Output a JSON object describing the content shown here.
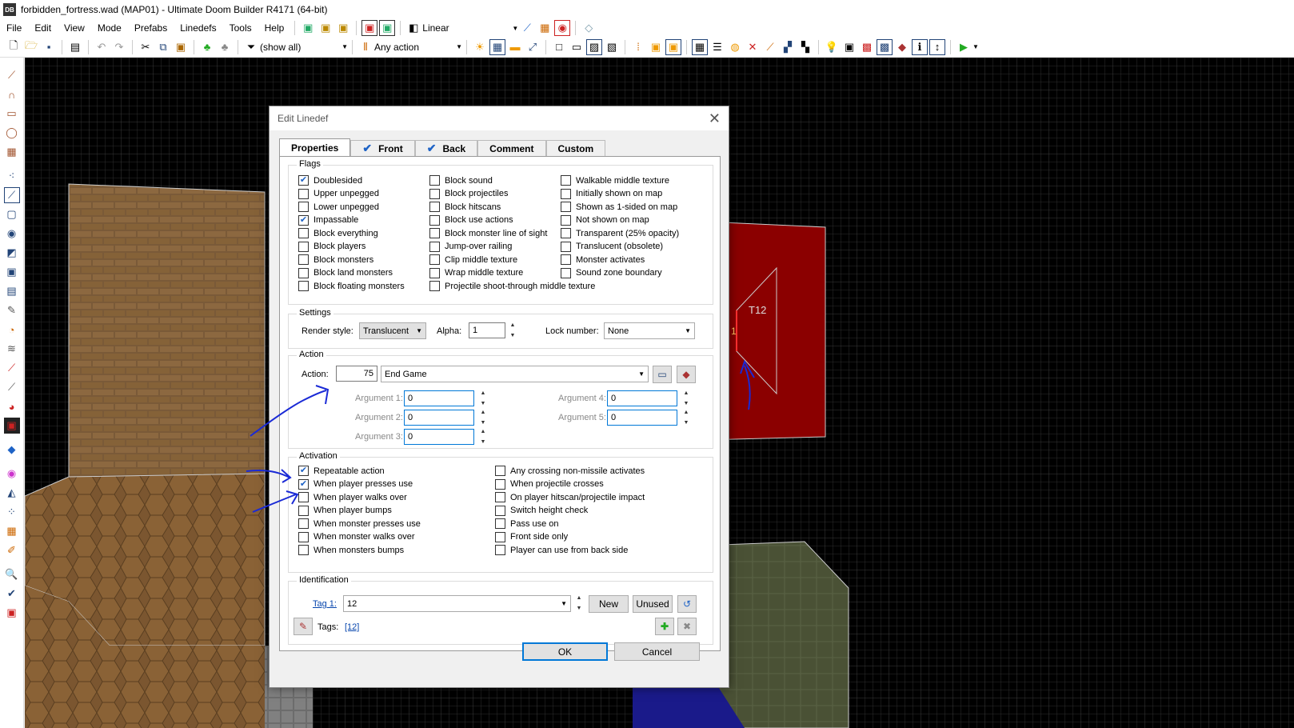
{
  "window": {
    "app_icon": "DB",
    "title": "forbidden_fortress.wad (MAP01) - Ultimate Doom Builder R4171 (64-bit)"
  },
  "menu": [
    "File",
    "Edit",
    "View",
    "Mode",
    "Prefabs",
    "Linedefs",
    "Tools",
    "Help"
  ],
  "toolbar": {
    "interpolation": "Linear",
    "filter": "(show all)",
    "action_filter": "Any action"
  },
  "map": {
    "thing_label": "T12",
    "line_index": "1"
  },
  "dialog": {
    "title": "Edit Linedef",
    "tabs": [
      {
        "label": "Properties",
        "checked": false
      },
      {
        "label": "Front",
        "checked": true
      },
      {
        "label": "Back",
        "checked": true
      },
      {
        "label": "Comment",
        "checked": false
      },
      {
        "label": "Custom",
        "checked": false
      }
    ],
    "flags": {
      "label": "Flags",
      "col1": [
        {
          "label": "Doublesided",
          "checked": true
        },
        {
          "label": "Upper unpegged",
          "checked": false
        },
        {
          "label": "Lower unpegged",
          "checked": false
        },
        {
          "label": "Impassable",
          "checked": true
        },
        {
          "label": "Block everything",
          "checked": false
        },
        {
          "label": "Block players",
          "checked": false
        },
        {
          "label": "Block monsters",
          "checked": false
        },
        {
          "label": "Block land monsters",
          "checked": false
        },
        {
          "label": "Block floating monsters",
          "checked": false
        }
      ],
      "col2": [
        {
          "label": "Block sound",
          "checked": false
        },
        {
          "label": "Block projectiles",
          "checked": false
        },
        {
          "label": "Block hitscans",
          "checked": false
        },
        {
          "label": "Block use actions",
          "checked": false
        },
        {
          "label": "Block monster line of sight",
          "checked": false
        },
        {
          "label": "Jump-over railing",
          "checked": false
        },
        {
          "label": "Clip middle texture",
          "checked": false
        },
        {
          "label": "Wrap middle texture",
          "checked": false
        },
        {
          "label": "Projectile shoot-through middle texture",
          "checked": false
        }
      ],
      "col3": [
        {
          "label": "Walkable middle texture",
          "checked": false
        },
        {
          "label": "Initially shown on map",
          "checked": false
        },
        {
          "label": "Shown as 1-sided on map",
          "checked": false
        },
        {
          "label": "Not shown on map",
          "checked": false
        },
        {
          "label": "Transparent (25% opacity)",
          "checked": false
        },
        {
          "label": "Translucent (obsolete)",
          "checked": false
        },
        {
          "label": "Monster activates",
          "checked": false
        },
        {
          "label": "Sound zone boundary",
          "checked": false
        }
      ]
    },
    "settings": {
      "label": "Settings",
      "render_style_label": "Render style:",
      "render_style": "Translucent",
      "alpha_label": "Alpha:",
      "alpha": "1",
      "lock_label": "Lock number:",
      "lock": "None"
    },
    "action": {
      "label": "Action",
      "action_label": "Action:",
      "number": "75",
      "name": "End Game",
      "args": [
        {
          "label": "Argument 1:",
          "value": "0"
        },
        {
          "label": "Argument 2:",
          "value": "0"
        },
        {
          "label": "Argument 3:",
          "value": "0"
        },
        {
          "label": "Argument 4:",
          "value": "0"
        },
        {
          "label": "Argument 5:",
          "value": "0"
        }
      ]
    },
    "activation": {
      "label": "Activation",
      "col1": [
        {
          "label": "Repeatable action",
          "checked": true
        },
        {
          "label": "When player presses use",
          "checked": true
        },
        {
          "label": "When player walks over",
          "checked": false
        },
        {
          "label": "When player bumps",
          "checked": false
        },
        {
          "label": "When monster presses use",
          "checked": false
        },
        {
          "label": "When monster walks over",
          "checked": false
        },
        {
          "label": "When monsters bumps",
          "checked": false
        }
      ],
      "col2": [
        {
          "label": "Any crossing non-missile activates",
          "checked": false
        },
        {
          "label": "When projectile crosses",
          "checked": false
        },
        {
          "label": "On player hitscan/projectile impact",
          "checked": false
        },
        {
          "label": "Switch height check",
          "checked": false
        },
        {
          "label": "Pass use on",
          "checked": false
        },
        {
          "label": "Front side only",
          "checked": false
        },
        {
          "label": "Player can use from back side",
          "checked": false
        }
      ]
    },
    "identification": {
      "label": "Identification",
      "tag_label": "Tag 1:",
      "tag": "12",
      "new_label": "New",
      "unused_label": "Unused",
      "tags_label": "Tags:",
      "tags_value": "[12]"
    },
    "ok_label": "OK",
    "cancel_label": "Cancel"
  },
  "colors": {
    "map_bg": "#000000",
    "sector_red": "#8b0000",
    "accent": "#0078d7",
    "annotation": "#1a2ad6"
  }
}
